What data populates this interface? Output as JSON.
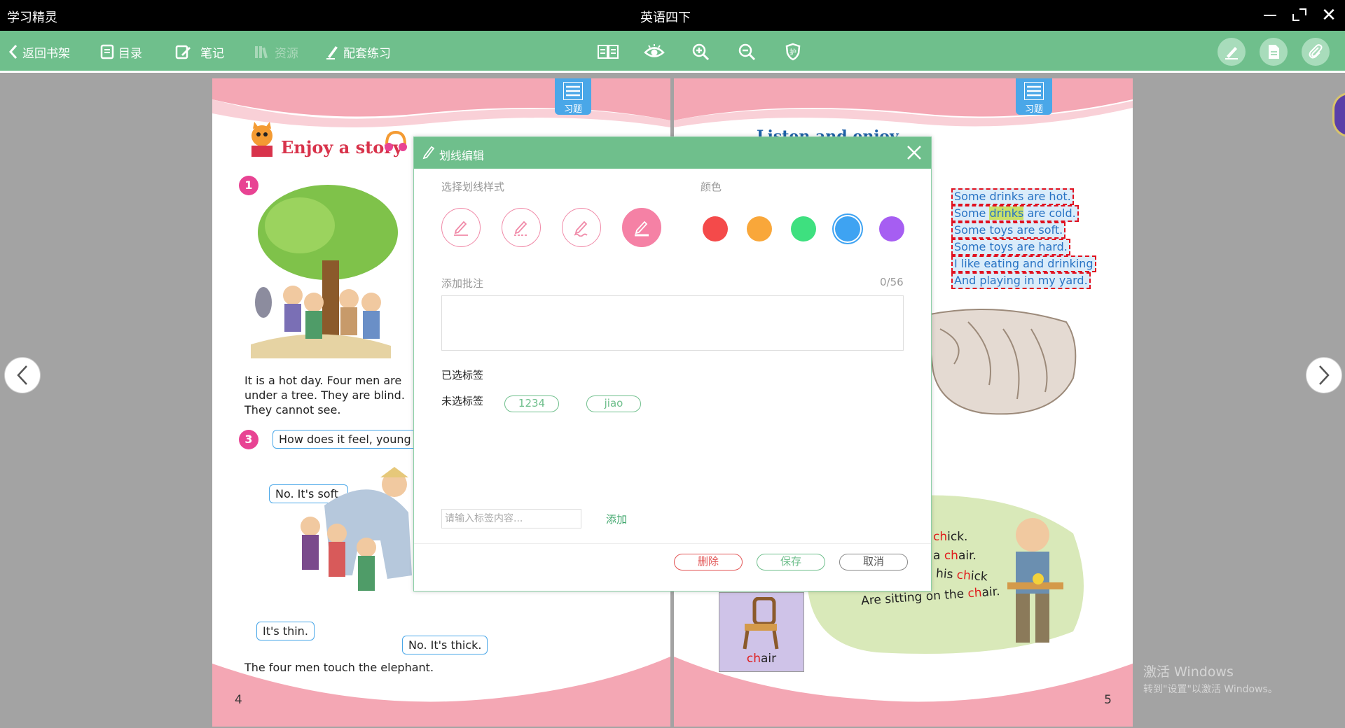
{
  "titlebar": {
    "app_name": "学习精灵",
    "doc_title": "英语四下"
  },
  "toolbar": {
    "back_label": "返回书架",
    "toc_label": "目录",
    "notes_label": "笔记",
    "resources_label": "资源",
    "practice_label": "配套练习"
  },
  "left_page": {
    "exercise_tab": "习题",
    "title": "Enjoy a story",
    "step1": "1",
    "step3": "3",
    "text_lines": [
      "It is a hot day. Four men are",
      "under a tree. They are blind.",
      "They cannot see."
    ],
    "bubble_question": "How does it feel, young",
    "bubble_soft": "No. It's soft.",
    "bubble_thin": "It's thin.",
    "bubble_thick": "No. It's thick.",
    "caption": "The four men touch the elephant.",
    "page_number": "4"
  },
  "right_page": {
    "exercise_tab": "习题",
    "title": "Listen and enjoy",
    "highlighted_lines": [
      "Some drinks are hot.",
      "Some drinks are cold.",
      "Some toys are soft.",
      "Some toys are hard.",
      "I like eating and drinking",
      "And playing in my yard."
    ],
    "highlight_word": "drinks",
    "chair_card": {
      "red": "ch",
      "rest": "air"
    },
    "rhyme_lines": {
      "l1_red": "ch",
      "l1_rest": "ick.",
      "l2_pre": "a ",
      "l2_red": "ch",
      "l2_rest": "air.",
      "l3_pre": "his ",
      "l3_red": "ch",
      "l3_rest": "ick",
      "l4_pre": "Are sitting on the ",
      "l4_red": "ch",
      "l4_rest": "air."
    },
    "page_number": "5"
  },
  "dialog": {
    "title": "划线编辑",
    "style_label": "选择划线样式",
    "color_label": "颜色",
    "colors": [
      "#f44a4a",
      "#f9a73a",
      "#3ee07f",
      "#3ea3f2",
      "#a65ef2"
    ],
    "selected_color": "#3ea3f2",
    "note_label": "添加批注",
    "note_count": "0/56",
    "selected_tags_label": "已选标签",
    "unselected_tags_label": "未选标签",
    "tags": [
      "1234",
      "jiao"
    ],
    "tag_placeholder": "请输入标签内容...",
    "add_label": "添加",
    "delete_label": "删除",
    "save_label": "保存",
    "cancel_label": "取消"
  },
  "watermark": {
    "line1": "激活 Windows",
    "line2": "转到\"设置\"以激活 Windows。"
  }
}
